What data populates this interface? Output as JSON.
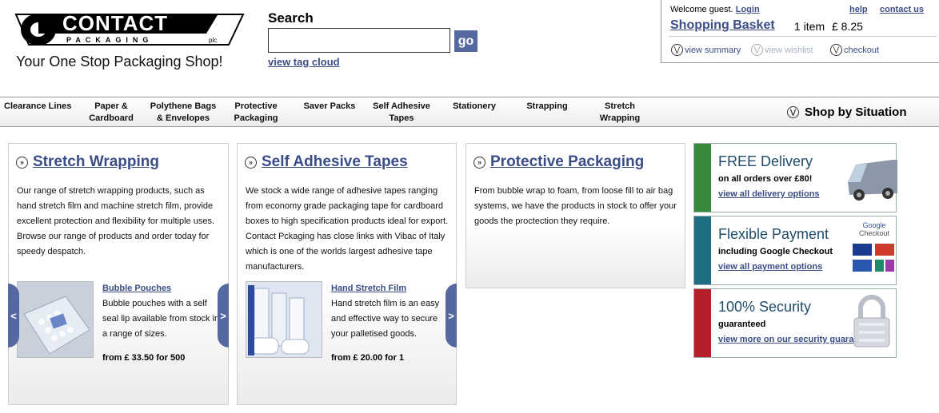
{
  "brand": {
    "logo_word": "CONTACT",
    "logo_sub": "PACKAGING",
    "logo_plc": "plc",
    "tagline": "Your One Stop Packaging Shop!"
  },
  "search": {
    "label": "Search",
    "value": "",
    "go_label": "go",
    "tag_cloud": "view tag cloud"
  },
  "account": {
    "welcome": "Welcome guest.",
    "login": "Login",
    "help": "help",
    "contact": "contact us",
    "basket_label": "Shopping Basket",
    "item_count": "1 item",
    "total": "£ 8.25",
    "view_summary": "view summary",
    "view_wishlist": "view wishlist",
    "checkout": "checkout"
  },
  "nav": {
    "items": [
      {
        "label": "Clearance Lines"
      },
      {
        "label": "Paper & Cardboard"
      },
      {
        "label": "Polythene Bags & Envelopes"
      },
      {
        "label": "Protective Packaging"
      },
      {
        "label": "Saver Packs"
      },
      {
        "label": "Self Adhesive Tapes"
      },
      {
        "label": "Stationery"
      },
      {
        "label": "Strapping"
      },
      {
        "label": "Stretch Wrapping"
      }
    ],
    "shop_by_situation": "Shop by Situation"
  },
  "panels": [
    {
      "title": "Stretch Wrapping",
      "text": "Our range of stretch wrapping products, such as hand stretch film and machine stretch film, provide excellent protection and flexibility for multiple uses. Browse our range of products and order today for speedy despatch.",
      "product_name": "Bubble Pouches",
      "product_desc": "Bubble pouches with a self seal lip available from stock in a range of sizes.",
      "product_price": "from £ 33.50 for 500"
    },
    {
      "title": "Self Adhesive Tapes",
      "text": "We stock a wide range of adhesive tapes ranging from economy grade packaging tape for cardboard boxes to high specification products ideal for export. Contact Pckaging has close links with Vibac of Italy which is one of the worlds largest adhesive tape manufacturers.",
      "product_name": "Hand Stretch Film",
      "product_desc": "Hand stretch film is an easy and effective way to secure your palletised goods.",
      "product_price": "from £ 20.00 for 1"
    },
    {
      "title": "Protective Packaging",
      "text": "From bubble wrap to foam, from loose fill to air bag systems, we have the products in stock to offer your goods the proctection they require."
    }
  ],
  "arrows": {
    "left": "<",
    "right": ">"
  },
  "promos": [
    {
      "head": "FREE Delivery",
      "sub": "on all orders over £80!",
      "more": "view all delivery options",
      "color": "#3a8a3e"
    },
    {
      "head": "Flexible Payment",
      "sub": "including Google Checkout",
      "more": "view all payment options",
      "color": "#1e6f82",
      "badge_top": "Google",
      "badge_bottom": "Checkout"
    },
    {
      "head": "100% Security",
      "sub": "guaranteed",
      "more": "view more on our security guarantee",
      "color": "#b61f2a"
    }
  ]
}
